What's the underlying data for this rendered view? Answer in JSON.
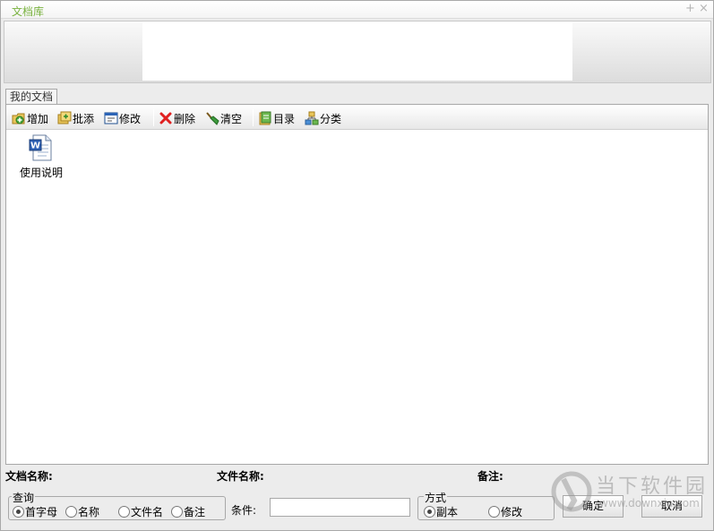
{
  "window": {
    "title": "文档库",
    "controls": {
      "pin": "+",
      "close": "×"
    }
  },
  "tab": {
    "label": "我的文档"
  },
  "toolbar": {
    "add": "增加",
    "batch_add": "批添",
    "edit": "修改",
    "delete": "删除",
    "clear": "清空",
    "directory": "目录",
    "category": "分类"
  },
  "documents": [
    {
      "name": "使用说明",
      "icon": "word-document-icon"
    }
  ],
  "info": {
    "doc_name_label": "文档名称:",
    "file_name_label": "文件名称:",
    "note_label": "备注:"
  },
  "query": {
    "legend": "查询",
    "options": [
      "首字母",
      "名称",
      "文件名",
      "备注"
    ],
    "selected": "首字母"
  },
  "condition": {
    "label": "条件:",
    "value": ""
  },
  "mode": {
    "legend": "方式",
    "options": [
      "副本",
      "修改"
    ],
    "selected": "副本"
  },
  "buttons": {
    "ok": "确定",
    "cancel": "取消"
  },
  "watermark": {
    "text": "当下软件园",
    "url": "www.downxia.com"
  },
  "colors": {
    "title": "#79b23f",
    "delete": "#e02020",
    "word": "#2b5fb3"
  }
}
